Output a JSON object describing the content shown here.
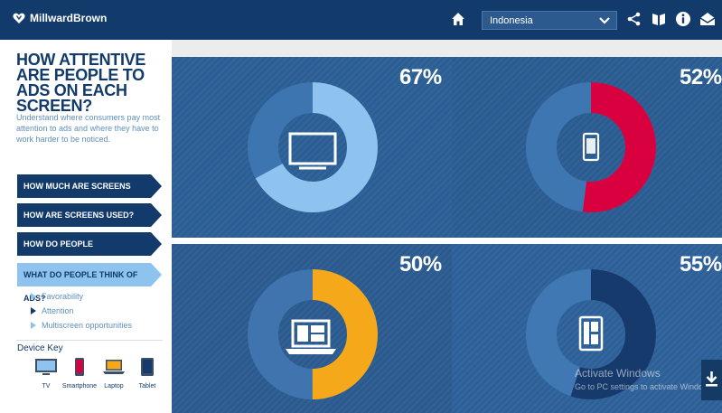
{
  "header": {
    "brand": "MillwardBrown",
    "country": "Indonesia"
  },
  "sidebar": {
    "title": "HOW ATTENTIVE ARE PEOPLE TO ADS ON EACH SCREEN?",
    "subtitle": "Understand where consumers pay most attention to ads and where they have to work harder to be noticed.",
    "nav": [
      {
        "label": "HOW MUCH ARE SCREENS USED?"
      },
      {
        "label": "HOW ARE SCREENS USED?"
      },
      {
        "label": "HOW DO PEOPLE MULTISCREEN?"
      },
      {
        "label": "WHAT DO PEOPLE THINK OF ADS?",
        "active": true
      }
    ],
    "subnav": [
      {
        "label": "Favorability"
      },
      {
        "label": "Attention",
        "current": true
      },
      {
        "label": "Multiscreen opportunities"
      }
    ],
    "device_key": {
      "title": "Device Key",
      "items": [
        {
          "label": "TV",
          "color": "#8ec2ef",
          "icon": "tv-icon"
        },
        {
          "label": "Smartphone",
          "color": "#d9003f",
          "icon": "smartphone-icon"
        },
        {
          "label": "Laptop",
          "color": "#f5a81c",
          "icon": "laptop-icon"
        },
        {
          "label": "Tablet",
          "color": "#163a6b",
          "icon": "tablet-icon"
        }
      ]
    }
  },
  "panels": [
    {
      "device": "TV",
      "value": 67,
      "percent": "67%",
      "color": "#8ec2ef",
      "bg": "#2b5e94",
      "ring": "#3d75b0",
      "icon": "tv-icon"
    },
    {
      "device": "Smartphone",
      "value": 52,
      "percent": "52%",
      "color": "#d9003f",
      "bg": "#2a5b91",
      "ring": "#3e76b1",
      "icon": "smartphone-icon"
    },
    {
      "device": "Laptop",
      "value": 50,
      "percent": "50%",
      "color": "#f6a81b",
      "bg": "#2a5a8e",
      "ring": "#3f74ae",
      "icon": "laptop-icon"
    },
    {
      "device": "Tablet",
      "value": 55,
      "percent": "55%",
      "color": "#163a6b",
      "bg": "#2d6098",
      "ring": "#3f78b3",
      "icon": "tablet-icon"
    }
  ],
  "watermark": {
    "line1": "Activate Windows",
    "line2": "Go to PC settings to activate Windows."
  }
}
